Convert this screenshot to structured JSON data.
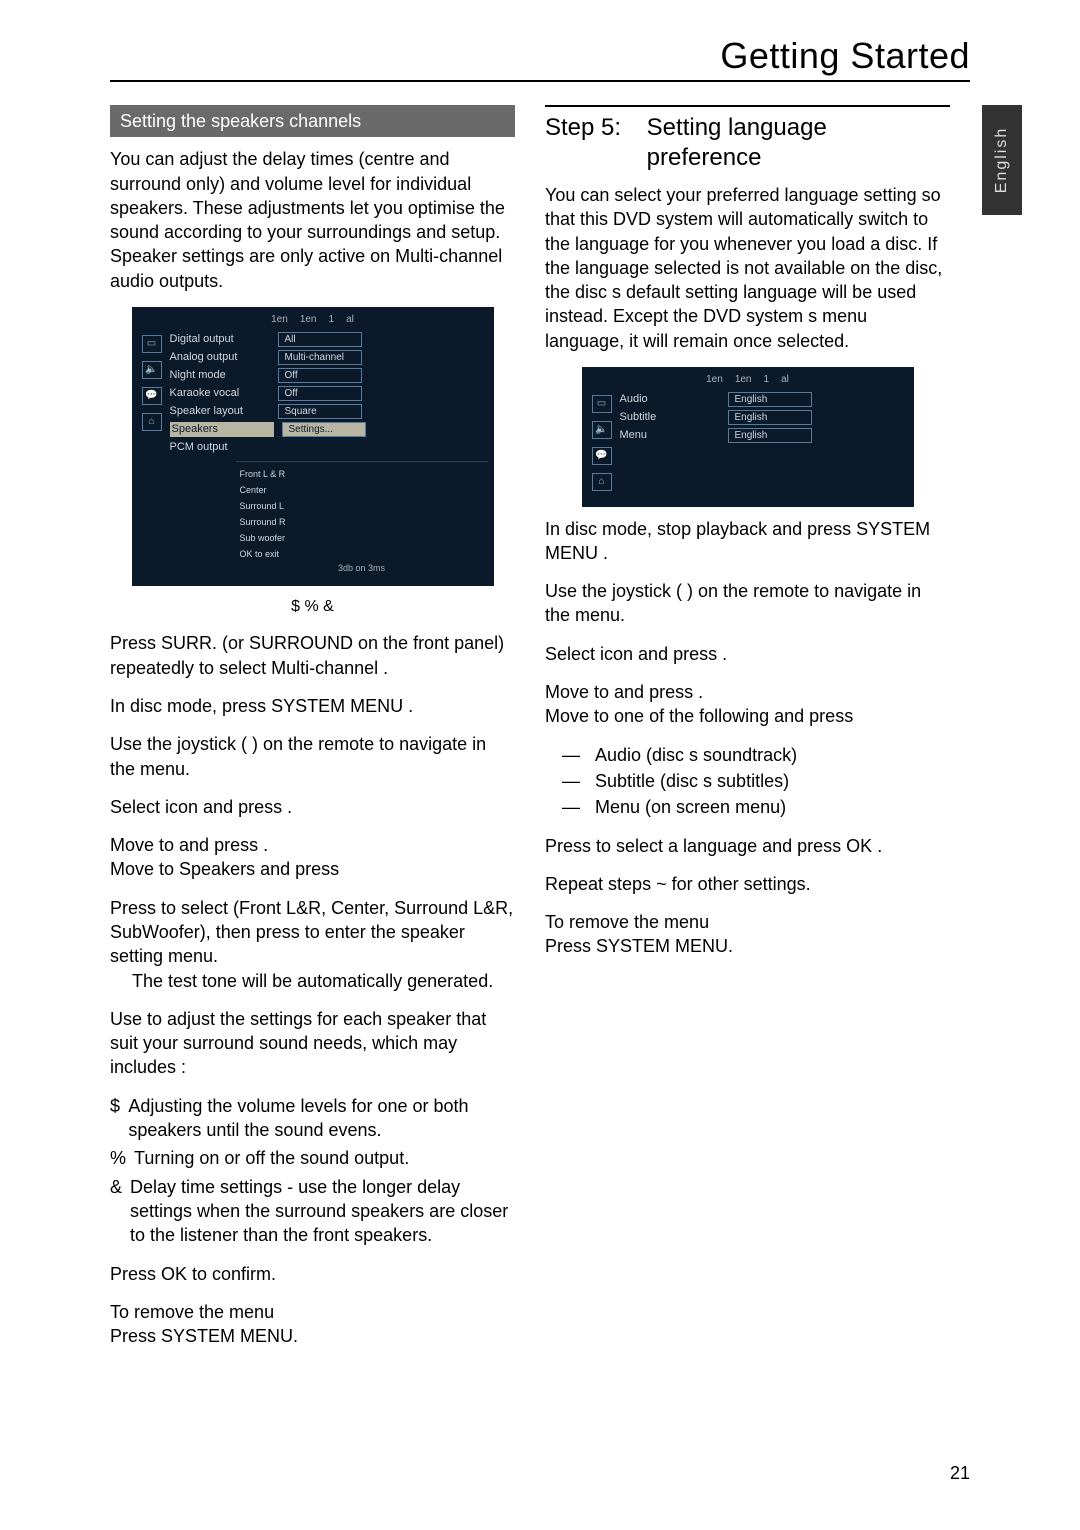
{
  "header": {
    "title": "Getting Started"
  },
  "lang_tab": "English",
  "page_number": "21",
  "left": {
    "subhead": "Setting the speakers    channels",
    "intro": "You can adjust the delay times (centre and surround only) and volume level for individual speakers. These adjustments let you optimise the sound according to your surroundings and setup.  Speaker settings are only active on Multi-channel audio outputs.",
    "osd_top": [
      "1en",
      "1en",
      "1",
      "al"
    ],
    "osd_rows": [
      {
        "label": "Digital output",
        "val": "All"
      },
      {
        "label": "Analog output",
        "val": "Multi-channel"
      },
      {
        "label": "Night mode",
        "val": "Off"
      },
      {
        "label": "Karaoke vocal",
        "val": "Off"
      },
      {
        "label": "Speaker layout",
        "val": "Square"
      },
      {
        "label": "Speakers",
        "val": "Settings...",
        "sel": true
      },
      {
        "label": "PCM output",
        "val": ""
      }
    ],
    "osd_nested": [
      {
        "label": "Front L & R"
      },
      {
        "label": "Center"
      },
      {
        "label": "Surround L"
      },
      {
        "label": "Surround R"
      },
      {
        "label": "Sub woofer"
      },
      {
        "label": "OK to exit"
      }
    ],
    "nested_footer": "3db  on  3ms",
    "markers": "$ % &",
    "s1": "Press SURR. (or SURROUND  on the front panel) repeatedly to select  Multi-channel .",
    "s2": "In disc mode, press SYSTEM MENU .",
    "s3": "Use the joystick (           ) on the remote to navigate in the menu.",
    "s4": "Select     icon and press  .",
    "s5a": "Move to        and press  .",
    "s5b": "Move to  Speakers  and press",
    "s6a": "Press        to select (Front L&R, Center, Surround L&R, SubWoofer), then press  to enter the speaker setting menu.",
    "s6b": "The test tone will be automatically generated.",
    "s7": "Use         to adjust the settings for each speaker that suit your surround sound needs, which may includes :",
    "li1": "Adjusting the volume levels for one or both speakers until the sound evens.",
    "li2": "Turning on or off the sound output.",
    "li3": "Delay time settings - use the longer delay settings when the surround speakers are closer to the listener than the front speakers.",
    "s8": "Press OK  to confirm.",
    "s9a": "To remove the menu",
    "s9b": "Press SYSTEM MENU."
  },
  "right": {
    "step_label": "Step 5:",
    "step_title": "Setting language preference",
    "intro": "You can select your preferred language setting so that this DVD system will automatically switch to the language for you whenever you load a disc.  If the language selected is not available on the disc, the disc s default setting language will be used instead.  Except the DVD system s menu language, it will remain once selected.",
    "osd_top": [
      "1en",
      "1en",
      "1",
      "al"
    ],
    "osd_rows": [
      {
        "label": "Audio",
        "val": "English"
      },
      {
        "label": "Subtitle",
        "val": "English"
      },
      {
        "label": "Menu",
        "val": "English"
      }
    ],
    "r1": "In disc mode, stop playback and press SYSTEM MENU .",
    "r2": "Use the joystick (           ) on the remote to navigate in the menu.",
    "r3": "Select     icon and press  .",
    "r4a": "Move to        and press  .",
    "r4b": "Move to one of the following and press",
    "d1": "Audio  (disc s soundtrack)",
    "d2": "Subtitle  (disc s subtitles)",
    "d3": "Menu  (on screen menu)",
    "r5": "Press        to select a language and press OK .",
    "r6": "Repeat steps   ~     for other settings.",
    "r7a": "To remove the menu",
    "r7b": "Press SYSTEM MENU."
  }
}
